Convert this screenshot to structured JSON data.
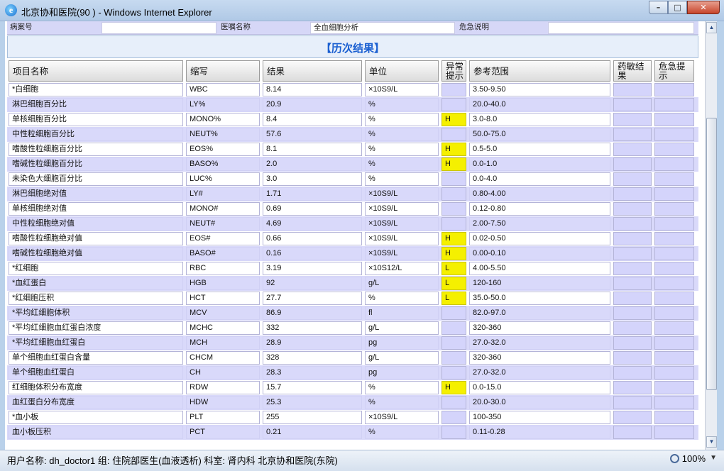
{
  "window": {
    "title": "北京协和医院(90 )  - Windows Internet Explorer",
    "min_label": "–",
    "max_label": "□",
    "close_label": "✕"
  },
  "topstrip": {
    "case_no_label": "病案号",
    "case_no_value": "",
    "order_name_label": "医嘱名称",
    "order_name_value": "全血细胞分析",
    "danger_label": "危急说明",
    "danger_value": ""
  },
  "history": {
    "title": "【历次结果】"
  },
  "table": {
    "headers": {
      "name": "项目名称",
      "abbr": "缩写",
      "result": "结果",
      "unit": "单位",
      "flag_l1": "异常",
      "flag_l2": "提示",
      "range": "参考范围",
      "drug_l1": "药敏结",
      "drug_l2": "果",
      "danger_l1": "危急提",
      "danger_l2": "示"
    },
    "rows": [
      {
        "name": "*白细胞",
        "abbr": "WBC",
        "result": "8.14",
        "unit": "×10S9/L",
        "flag": "",
        "range": "3.50-9.50"
      },
      {
        "name": "淋巴细胞百分比",
        "abbr": "LY%",
        "result": "20.9",
        "unit": "%",
        "flag": "",
        "range": "20.0-40.0"
      },
      {
        "name": "单核细胞百分比",
        "abbr": "MONO%",
        "result": "8.4",
        "unit": "%",
        "flag": "H",
        "range": "3.0-8.0"
      },
      {
        "name": "中性粒细胞百分比",
        "abbr": "NEUT%",
        "result": "57.6",
        "unit": "%",
        "flag": "",
        "range": "50.0-75.0"
      },
      {
        "name": "嗜酸性粒细胞百分比",
        "abbr": "EOS%",
        "result": "8.1",
        "unit": "%",
        "flag": "H",
        "range": "0.5-5.0"
      },
      {
        "name": "嗜碱性粒细胞百分比",
        "abbr": "BASO%",
        "result": "2.0",
        "unit": "%",
        "flag": "H",
        "range": "0.0-1.0"
      },
      {
        "name": "未染色大细胞百分比",
        "abbr": "LUC%",
        "result": "3.0",
        "unit": "%",
        "flag": "",
        "range": "0.0-4.0"
      },
      {
        "name": "淋巴细胞绝对值",
        "abbr": "LY#",
        "result": "1.71",
        "unit": "×10S9/L",
        "flag": "",
        "range": "0.80-4.00"
      },
      {
        "name": "单核细胞绝对值",
        "abbr": "MONO#",
        "result": "0.69",
        "unit": "×10S9/L",
        "flag": "",
        "range": "0.12-0.80"
      },
      {
        "name": "中性粒细胞绝对值",
        "abbr": "NEUT#",
        "result": "4.69",
        "unit": "×10S9/L",
        "flag": "",
        "range": "2.00-7.50"
      },
      {
        "name": "嗜酸性粒细胞绝对值",
        "abbr": "EOS#",
        "result": "0.66",
        "unit": "×10S9/L",
        "flag": "H",
        "range": "0.02-0.50"
      },
      {
        "name": "嗜碱性粒细胞绝对值",
        "abbr": "BASO#",
        "result": "0.16",
        "unit": "×10S9/L",
        "flag": "H",
        "range": "0.00-0.10"
      },
      {
        "name": "*红细胞",
        "abbr": "RBC",
        "result": "3.19",
        "unit": "×10S12/L",
        "flag": "L",
        "range": "4.00-5.50"
      },
      {
        "name": "*血红蛋白",
        "abbr": "HGB",
        "result": "92",
        "unit": "g/L",
        "flag": "L",
        "range": "120-160"
      },
      {
        "name": "*红细胞压积",
        "abbr": "HCT",
        "result": "27.7",
        "unit": "%",
        "flag": "L",
        "range": "35.0-50.0"
      },
      {
        "name": "*平均红细胞体积",
        "abbr": "MCV",
        "result": "86.9",
        "unit": "fl",
        "flag": "",
        "range": "82.0-97.0"
      },
      {
        "name": "*平均红细胞血红蛋白浓度",
        "abbr": "MCHC",
        "result": "332",
        "unit": "g/L",
        "flag": "",
        "range": "320-360"
      },
      {
        "name": "*平均红细胞血红蛋白",
        "abbr": "MCH",
        "result": "28.9",
        "unit": "pg",
        "flag": "",
        "range": "27.0-32.0"
      },
      {
        "name": "单个细胞血红蛋白含量",
        "abbr": "CHCM",
        "result": "328",
        "unit": "g/L",
        "flag": "",
        "range": "320-360"
      },
      {
        "name": "单个细胞血红蛋白",
        "abbr": "CH",
        "result": "28.3",
        "unit": "pg",
        "flag": "",
        "range": "27.0-32.0"
      },
      {
        "name": "红细胞体积分布宽度",
        "abbr": "RDW",
        "result": "15.7",
        "unit": "%",
        "flag": "H",
        "range": "0.0-15.0"
      },
      {
        "name": "血红蛋白分布宽度",
        "abbr": "HDW",
        "result": "25.3",
        "unit": "%",
        "flag": "",
        "range": "20.0-30.0"
      },
      {
        "name": "*血小板",
        "abbr": "PLT",
        "result": "255",
        "unit": "×10S9/L",
        "flag": "",
        "range": "100-350"
      },
      {
        "name": "血小板压积",
        "abbr": "PCT",
        "result": "0.21",
        "unit": "%",
        "flag": "",
        "range": "0.11-0.28"
      }
    ]
  },
  "status": {
    "text": "用户名称:  dh_doctor1  组:  住院部医生(血液透析)  科室: 肾内科 北京协和医院(东院)",
    "zoom": "100%"
  },
  "colors": {
    "highlight": "#f5f000",
    "alt_row": "#d9d9fa",
    "history_title": "#1a5fd1"
  }
}
